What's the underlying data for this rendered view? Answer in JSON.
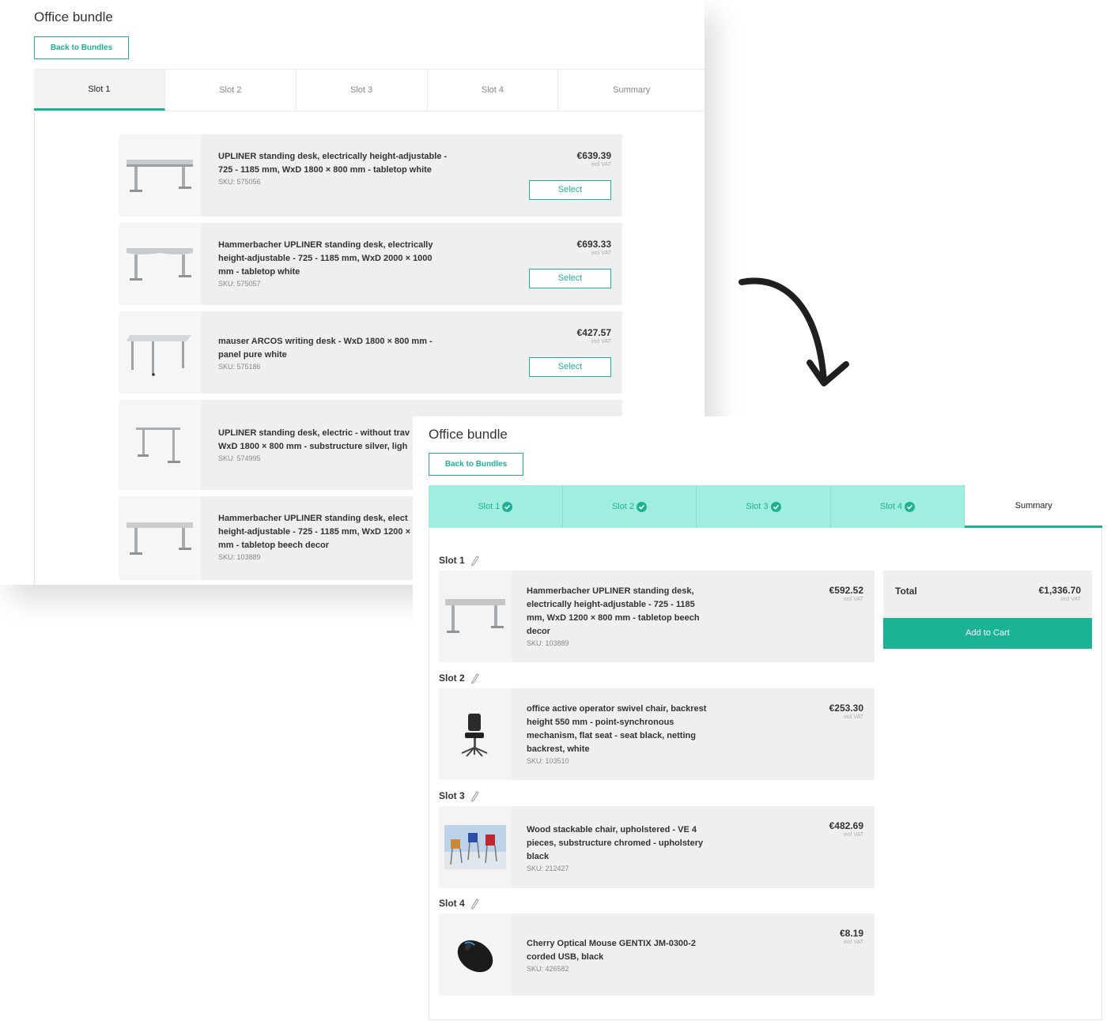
{
  "colors": {
    "accent": "#1cb394",
    "tab_done_bg": "#a1eee0",
    "row_bg": "#efefef"
  },
  "screen1": {
    "title": "Office bundle",
    "back_label": "Back to Bundles",
    "tabs": [
      "Slot 1",
      "Slot 2",
      "Slot 3",
      "Slot 4",
      "Summary"
    ],
    "active_tab": "Slot 1",
    "products": [
      {
        "name": "UPLINER standing desk, electrically height-adjustable - 725 - 1185 mm, WxD 1800 × 800 mm - tabletop white",
        "sku": "SKU: 575056",
        "price": "€639.39",
        "vat": "incl VAT",
        "select": "Select",
        "icon": "standing-desk-icon"
      },
      {
        "name": "Hammerbacher UPLINER standing desk, electrically height-adjustable - 725 - 1185 mm, WxD 2000 × 1000 mm - tabletop white",
        "sku": "SKU: 575057",
        "price": "€693.33",
        "vat": "incl VAT",
        "select": "Select",
        "icon": "standing-desk-icon"
      },
      {
        "name": "mauser ARCOS writing desk - WxD 1800 × 800 mm - panel pure white",
        "sku": "SKU: 575186",
        "price": "€427.57",
        "vat": "incl VAT",
        "select": "Select",
        "icon": "writing-desk-icon"
      },
      {
        "name": "UPLINER standing desk, electric - without trav WxD 1800 × 800 mm - substructure silver, ligh",
        "sku": "SKU: 574995",
        "icon": "desk-frame-icon"
      },
      {
        "name": "Hammerbacher UPLINER standing desk, elect height-adjustable - 725 - 1185 mm, WxD 1200 × mm - tabletop beech decor",
        "sku": "SKU: 103889",
        "icon": "standing-desk-icon"
      }
    ]
  },
  "screen2": {
    "title": "Office bundle",
    "back_label": "Back to Bundles",
    "tabs": [
      "Slot 1",
      "Slot 2",
      "Slot 3",
      "Slot 4",
      "Summary"
    ],
    "active_tab": "Summary",
    "slots": [
      {
        "label": "Slot 1",
        "name": "Hammerbacher UPLINER standing desk, electrically height-adjustable - 725 - 1185 mm, WxD 1200 × 800 mm - tabletop beech decor",
        "sku": "SKU: 103889",
        "price": "€592.52",
        "vat": "incl VAT",
        "icon": "standing-desk-icon"
      },
      {
        "label": "Slot 2",
        "name": "office active operator swivel chair, backrest height 550 mm - point-synchronous mechanism, flat seat - seat black, netting backrest, white",
        "sku": "SKU: 103510",
        "price": "€253.30",
        "vat": "incl VAT",
        "icon": "swivel-chair-icon"
      },
      {
        "label": "Slot 3",
        "name": "Wood stackable chair, upholstered - VE 4 pieces, substructure chromed - upholstery black",
        "sku": "SKU: 212427",
        "price": "€482.69",
        "vat": "incl VAT",
        "icon": "stackable-chairs-image"
      },
      {
        "label": "Slot 4",
        "name": "Cherry Optical Mouse GENTIX JM-0300-2 corded USB, black",
        "sku": "SKU: 426582",
        "price": "€8.19",
        "vat": "incl VAT",
        "icon": "mouse-icon"
      }
    ],
    "total": {
      "label": "Total",
      "value": "€1,336.70",
      "vat": "incl VAT"
    },
    "add_to_cart": "Add to Cart"
  }
}
